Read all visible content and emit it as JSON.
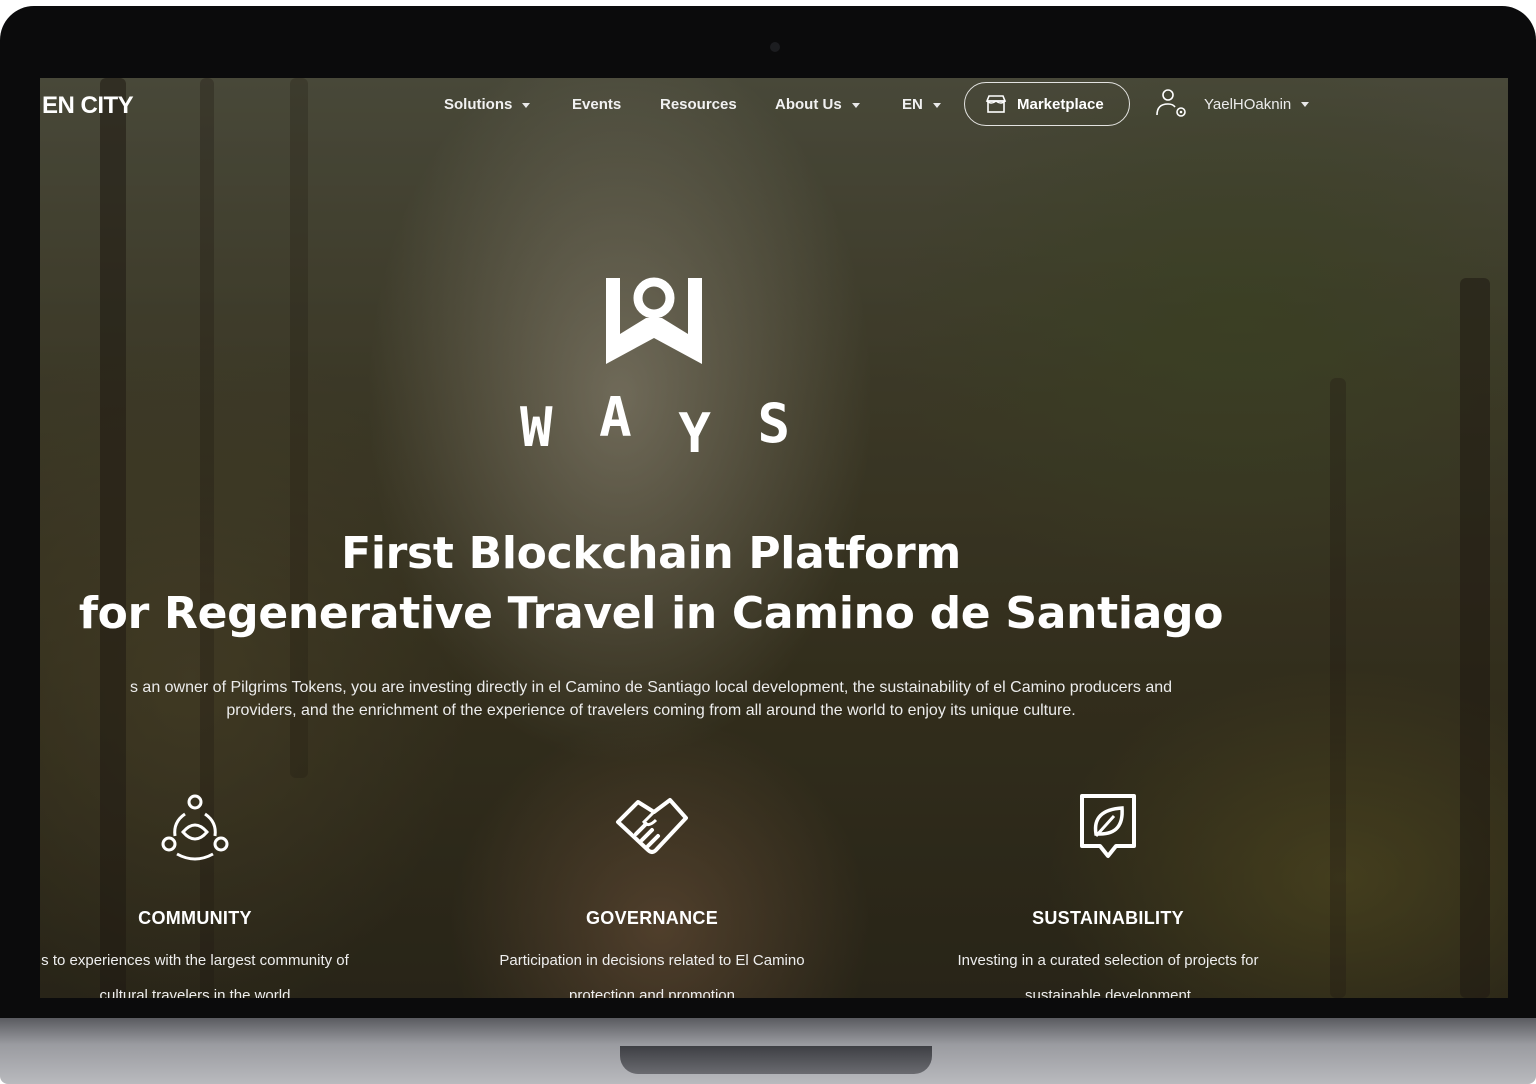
{
  "nav": {
    "brand": "EN CITY",
    "items": [
      {
        "label": "Solutions",
        "dropdown": true
      },
      {
        "label": "Events",
        "dropdown": false
      },
      {
        "label": "Resources",
        "dropdown": false
      },
      {
        "label": "About Us",
        "dropdown": true
      },
      {
        "label": "EN",
        "dropdown": true
      }
    ],
    "marketplace_label": "Marketplace",
    "username": "YaelHOaknin"
  },
  "hero": {
    "logo_text": [
      "W",
      "A",
      "Y",
      "S"
    ],
    "headline_line1": "First Blockchain Platform",
    "headline_line2": "for Regenerative Travel in Camino de Santiago",
    "description_line1": "s an owner of Pilgrims Tokens, you are investing directly in el Camino de Santiago local development, the sustainability of el Camino producers and",
    "description_line2": "providers, and the enrichment of the experience of travelers coming from all around the world to enjoy its unique culture."
  },
  "features": [
    {
      "icon": "community-icon",
      "title": "COMMUNITY",
      "desc_line1": "s to experiences with the largest community of",
      "desc_line2": "cultural travelers in the world"
    },
    {
      "icon": "handshake-icon",
      "title": "GOVERNANCE",
      "desc_line1": "Participation in decisions related to El Camino",
      "desc_line2": "protection and promotion"
    },
    {
      "icon": "leaf-badge-icon",
      "title": "SUSTAINABILITY",
      "desc_line1": "Investing in a curated selection of projects for",
      "desc_line2": "sustainable development"
    }
  ],
  "colors": {
    "text": "#ffffff",
    "laptop_bezel": "#0b0b0c",
    "forest_dark": "#2f2a1c"
  }
}
